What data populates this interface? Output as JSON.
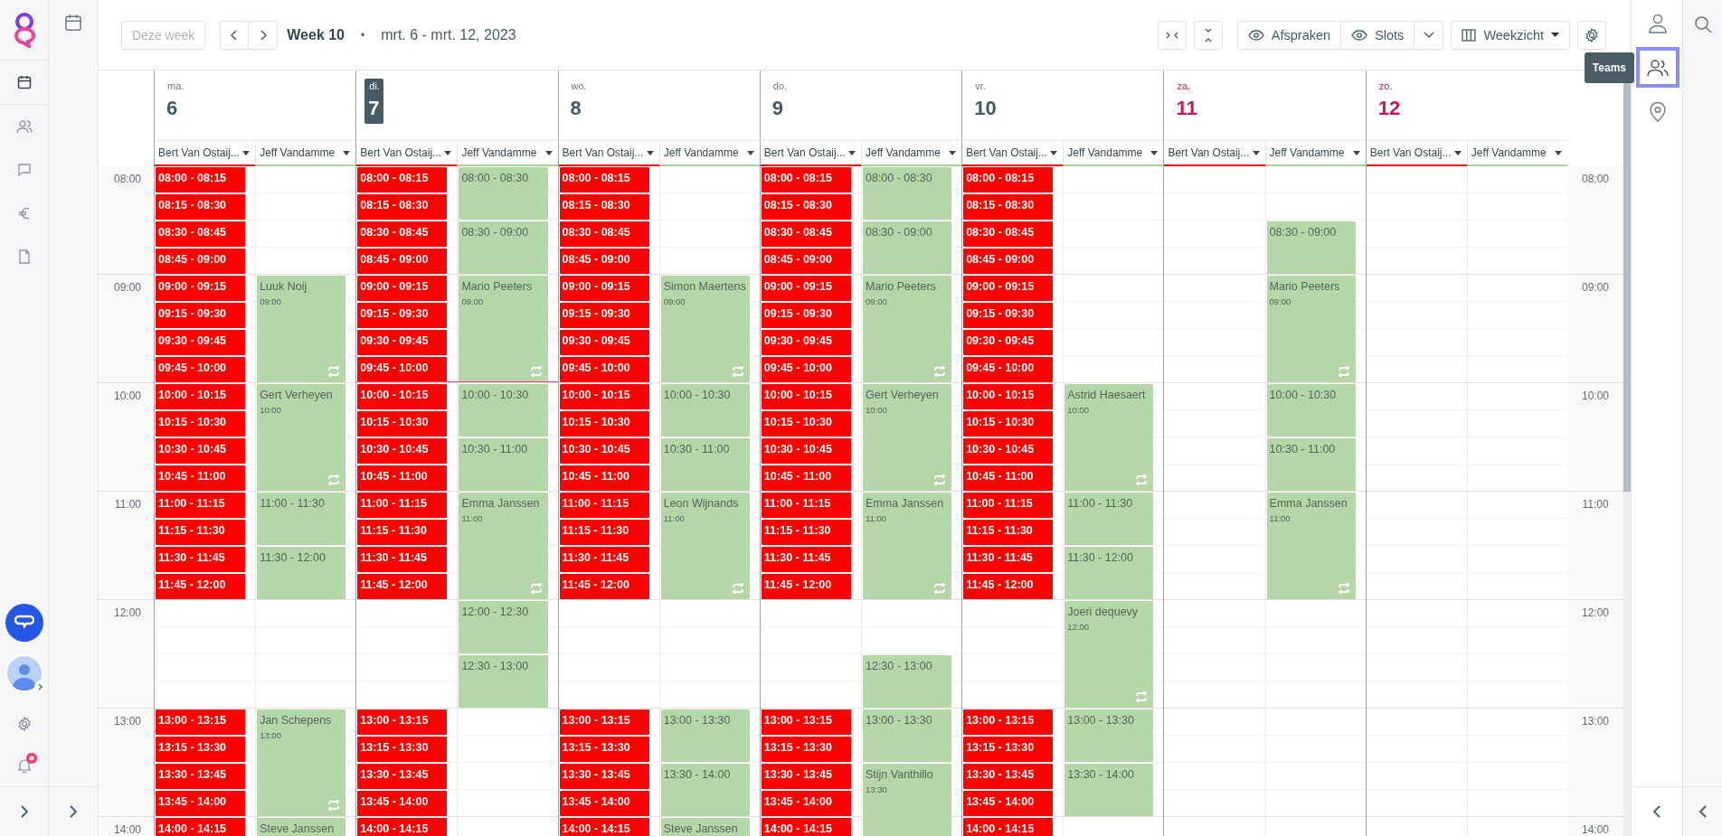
{
  "left_nav": {
    "items": [
      {
        "kind": "calendar",
        "selected": true
      },
      {
        "kind": "people",
        "selected": false
      },
      {
        "kind": "chat",
        "selected": false
      },
      {
        "kind": "euro",
        "selected": false
      },
      {
        "kind": "document",
        "selected": false
      }
    ],
    "notifications": {
      "unread": true
    }
  },
  "toolbar": {
    "today_button": {
      "label": "Deze week",
      "disabled": true
    },
    "week_label": "Week 10",
    "separator": "•",
    "date_range": "mrt. 6 - mrt. 12, 2023",
    "toggles": [
      {
        "label": "Afspraken",
        "visible": true
      },
      {
        "label": "Slots",
        "visible": true
      }
    ],
    "view_select": "Weekzicht"
  },
  "times_left": [
    "08:00",
    "09:00",
    "10:00",
    "11:00",
    "12:00",
    "13:00",
    "14:00"
  ],
  "times_right": [
    "08:00",
    "09:00",
    "10:00",
    "11:00",
    "12:00",
    "13:00",
    "14:00"
  ],
  "days": [
    {
      "weekday": "ma.",
      "date": "6",
      "selected": false,
      "weekend": false,
      "columns": [
        {
          "resource": "Bert Van Ostaij...",
          "color": "#ff0000",
          "blocks": [
            {
              "kind": "slot",
              "label": "08:00 - 08:15"
            },
            {
              "kind": "slot",
              "label": "08:15 - 08:30"
            },
            {
              "kind": "slot",
              "label": "08:30 - 08:45"
            },
            {
              "kind": "slot",
              "label": "08:45 - 09:00"
            },
            {
              "kind": "slot",
              "label": "09:00 - 09:15"
            },
            {
              "kind": "slot",
              "label": "09:15 - 09:30"
            },
            {
              "kind": "slot",
              "label": "09:30 - 09:45"
            },
            {
              "kind": "slot",
              "label": "09:45 - 10:00"
            },
            {
              "kind": "slot",
              "label": "10:00 - 10:15"
            },
            {
              "kind": "slot",
              "label": "10:15 - 10:30"
            },
            {
              "kind": "slot",
              "label": "10:30 - 10:45"
            },
            {
              "kind": "slot",
              "label": "10:45 - 11:00"
            },
            {
              "kind": "slot",
              "label": "11:00 - 11:15"
            },
            {
              "kind": "slot",
              "label": "11:15 - 11:30"
            },
            {
              "kind": "slot",
              "label": "11:30 - 11:45"
            },
            {
              "kind": "slot",
              "label": "11:45 - 12:00"
            },
            {
              "kind": "free"
            },
            {
              "kind": "free"
            },
            {
              "kind": "free"
            },
            {
              "kind": "free"
            },
            {
              "kind": "slot",
              "label": "13:00 - 13:15"
            },
            {
              "kind": "slot",
              "label": "13:15 - 13:30"
            },
            {
              "kind": "slot",
              "label": "13:30 - 13:45"
            },
            {
              "kind": "slot",
              "label": "13:45 - 14:00"
            },
            {
              "kind": "slot",
              "label": "14:00 - 14:15"
            }
          ]
        },
        {
          "resource": "Jeff Vandamme",
          "color": "#a5d196",
          "blocks": [
            {
              "kind": "free"
            },
            {
              "kind": "free"
            },
            {
              "kind": "free"
            },
            {
              "kind": "free"
            },
            {
              "kind": "appointment",
              "name": "Luuk Noij",
              "time": "09:00",
              "repeat": true
            },
            {
              "kind": "appointment",
              "name": "Gert Verheyen",
              "time": "10:00",
              "repeat": true
            },
            {
              "kind": "open",
              "label": "11:00 - 11:30"
            },
            {
              "kind": "open",
              "label": "11:30 - 12:00"
            },
            {
              "kind": "free"
            },
            {
              "kind": "free"
            },
            {
              "kind": "free"
            },
            {
              "kind": "free"
            },
            {
              "kind": "appointment",
              "name": "Jan Schepens",
              "time": "13:00",
              "repeat": true
            },
            {
              "kind": "appointment",
              "name": "Steve Janssen"
            }
          ]
        }
      ]
    },
    {
      "weekday": "di.",
      "date": "7",
      "selected": true,
      "weekend": false,
      "columns": [
        {
          "resource": "Bert Van Ostaij...",
          "color": "#ff0000",
          "blocks": [
            {
              "kind": "slot",
              "label": "08:00 - 08:15"
            },
            {
              "kind": "slot",
              "label": "08:15 - 08:30"
            },
            {
              "kind": "slot",
              "label": "08:30 - 08:45"
            },
            {
              "kind": "slot",
              "label": "08:45 - 09:00"
            },
            {
              "kind": "slot",
              "label": "09:00 - 09:15"
            },
            {
              "kind": "slot",
              "label": "09:15 - 09:30"
            },
            {
              "kind": "slot",
              "label": "09:30 - 09:45"
            },
            {
              "kind": "slot",
              "label": "09:45 - 10:00"
            },
            {
              "kind": "slot",
              "label": "10:00 - 10:15"
            },
            {
              "kind": "slot",
              "label": "10:15 - 10:30"
            },
            {
              "kind": "slot",
              "label": "10:30 - 10:45"
            },
            {
              "kind": "slot",
              "label": "10:45 - 11:00"
            },
            {
              "kind": "slot",
              "label": "11:00 - 11:15"
            },
            {
              "kind": "slot",
              "label": "11:15 - 11:30"
            },
            {
              "kind": "slot",
              "label": "11:30 - 11:45"
            },
            {
              "kind": "slot",
              "label": "11:45 - 12:00"
            },
            {
              "kind": "free"
            },
            {
              "kind": "free"
            },
            {
              "kind": "free"
            },
            {
              "kind": "free"
            },
            {
              "kind": "slot",
              "label": "13:00 - 13:15"
            },
            {
              "kind": "slot",
              "label": "13:15 - 13:30"
            },
            {
              "kind": "slot",
              "label": "13:30 - 13:45"
            },
            {
              "kind": "slot",
              "label": "13:45 - 14:00"
            },
            {
              "kind": "slot",
              "label": "14:00 - 14:15"
            }
          ]
        },
        {
          "resource": "Jeff Vandamme",
          "color": "#a5d196",
          "blocks": [
            {
              "kind": "open",
              "label": "08:00 - 08:30"
            },
            {
              "kind": "open",
              "label": "08:30 - 09:00"
            },
            {
              "kind": "appointment",
              "name": "Mario Peeters",
              "time": "09:00",
              "repeat": true
            },
            {
              "kind": "open",
              "label": "10:00 - 10:30"
            },
            {
              "kind": "open",
              "label": "10:30 - 11:00"
            },
            {
              "kind": "appointment",
              "name": "Emma Janssen",
              "time": "11:00",
              "repeat": true
            },
            {
              "kind": "open",
              "label": "12:00 - 12:30"
            },
            {
              "kind": "open",
              "label": "12:30 - 13:00"
            }
          ]
        }
      ]
    },
    {
      "weekday": "wo.",
      "date": "8",
      "selected": false,
      "weekend": false,
      "columns": [
        {
          "resource": "Bert Van Ostaij...",
          "color": "#ff0000",
          "blocks": [
            {
              "kind": "slot",
              "label": "08:00 - 08:15"
            },
            {
              "kind": "slot",
              "label": "08:15 - 08:30"
            },
            {
              "kind": "slot",
              "label": "08:30 - 08:45"
            },
            {
              "kind": "slot",
              "label": "08:45 - 09:00"
            },
            {
              "kind": "slot",
              "label": "09:00 - 09:15"
            },
            {
              "kind": "slot",
              "label": "09:15 - 09:30"
            },
            {
              "kind": "slot",
              "label": "09:30 - 09:45"
            },
            {
              "kind": "slot",
              "label": "09:45 - 10:00"
            },
            {
              "kind": "slot",
              "label": "10:00 - 10:15"
            },
            {
              "kind": "slot",
              "label": "10:15 - 10:30"
            },
            {
              "kind": "slot",
              "label": "10:30 - 10:45"
            },
            {
              "kind": "slot",
              "label": "10:45 - 11:00"
            },
            {
              "kind": "slot",
              "label": "11:00 - 11:15"
            },
            {
              "kind": "slot",
              "label": "11:15 - 11:30"
            },
            {
              "kind": "slot",
              "label": "11:30 - 11:45"
            },
            {
              "kind": "slot",
              "label": "11:45 - 12:00"
            },
            {
              "kind": "free"
            },
            {
              "kind": "free"
            },
            {
              "kind": "free"
            },
            {
              "kind": "free"
            },
            {
              "kind": "slot",
              "label": "13:00 - 13:15"
            },
            {
              "kind": "slot",
              "label": "13:15 - 13:30"
            },
            {
              "kind": "slot",
              "label": "13:30 - 13:45"
            },
            {
              "kind": "slot",
              "label": "13:45 - 14:00"
            },
            {
              "kind": "slot",
              "label": "14:00 - 14:15"
            }
          ]
        },
        {
          "resource": "Jeff Vandamme",
          "color": "#a5d196",
          "blocks": [
            {
              "kind": "free"
            },
            {
              "kind": "free"
            },
            {
              "kind": "free"
            },
            {
              "kind": "free"
            },
            {
              "kind": "appointment",
              "name": "Simon Maertens",
              "time": "09:00",
              "repeat": true
            },
            {
              "kind": "open",
              "label": "10:00 - 10:30"
            },
            {
              "kind": "open",
              "label": "10:30 - 11:00"
            },
            {
              "kind": "appointment",
              "name": "Leon Wijnands",
              "time": "11:00",
              "repeat": true
            },
            {
              "kind": "free"
            },
            {
              "kind": "free"
            },
            {
              "kind": "free"
            },
            {
              "kind": "free"
            },
            {
              "kind": "open",
              "label": "13:00 - 13:30"
            },
            {
              "kind": "open",
              "label": "13:30 - 14:00"
            },
            {
              "kind": "appointment",
              "name": "Steve Janssen"
            }
          ]
        }
      ]
    },
    {
      "weekday": "do.",
      "date": "9",
      "selected": false,
      "weekend": false,
      "columns": [
        {
          "resource": "Bert Van Ostaij...",
          "color": "#ff0000",
          "blocks": [
            {
              "kind": "slot",
              "label": "08:00 - 08:15"
            },
            {
              "kind": "slot",
              "label": "08:15 - 08:30"
            },
            {
              "kind": "slot",
              "label": "08:30 - 08:45"
            },
            {
              "kind": "slot",
              "label": "08:45 - 09:00"
            },
            {
              "kind": "slot",
              "label": "09:00 - 09:15"
            },
            {
              "kind": "slot",
              "label": "09:15 - 09:30"
            },
            {
              "kind": "slot",
              "label": "09:30 - 09:45"
            },
            {
              "kind": "slot",
              "label": "09:45 - 10:00"
            },
            {
              "kind": "slot",
              "label": "10:00 - 10:15"
            },
            {
              "kind": "slot",
              "label": "10:15 - 10:30"
            },
            {
              "kind": "slot",
              "label": "10:30 - 10:45"
            },
            {
              "kind": "slot",
              "label": "10:45 - 11:00"
            },
            {
              "kind": "slot",
              "label": "11:00 - 11:15"
            },
            {
              "kind": "slot",
              "label": "11:15 - 11:30"
            },
            {
              "kind": "slot",
              "label": "11:30 - 11:45"
            },
            {
              "kind": "slot",
              "label": "11:45 - 12:00"
            },
            {
              "kind": "free"
            },
            {
              "kind": "free"
            },
            {
              "kind": "free"
            },
            {
              "kind": "free"
            },
            {
              "kind": "slot",
              "label": "13:00 - 13:15"
            },
            {
              "kind": "slot",
              "label": "13:15 - 13:30"
            },
            {
              "kind": "slot",
              "label": "13:30 - 13:45"
            },
            {
              "kind": "slot",
              "label": "13:45 - 14:00"
            },
            {
              "kind": "slot",
              "label": "14:00 - 14:15"
            }
          ]
        },
        {
          "resource": "Jeff Vandamme",
          "color": "#a5d196",
          "blocks": [
            {
              "kind": "open",
              "label": "08:00 - 08:30"
            },
            {
              "kind": "open",
              "label": "08:30 - 09:00"
            },
            {
              "kind": "appointment",
              "name": "Mario Peeters",
              "time": "09:00",
              "repeat": true
            },
            {
              "kind": "appointment",
              "name": "Gert Verheyen",
              "time": "10:00",
              "repeat": true
            },
            {
              "kind": "appointment",
              "name": "Emma Janssen",
              "time": "11:00",
              "repeat": true
            },
            {
              "kind": "free"
            },
            {
              "kind": "free"
            },
            {
              "kind": "open",
              "label": "12:30 - 13:00"
            },
            {
              "kind": "open",
              "label": "13:00 - 13:30"
            },
            {
              "kind": "appointment",
              "name": "Stijn Vanthillo",
              "time": "13:30"
            }
          ]
        }
      ]
    },
    {
      "weekday": "vr.",
      "date": "10",
      "selected": false,
      "weekend": false,
      "columns": [
        {
          "resource": "Bert Van Ostaij...",
          "color": "#ff0000",
          "blocks": [
            {
              "kind": "slot",
              "label": "08:00 - 08:15"
            },
            {
              "kind": "slot",
              "label": "08:15 - 08:30"
            },
            {
              "kind": "slot",
              "label": "08:30 - 08:45"
            },
            {
              "kind": "slot",
              "label": "08:45 - 09:00"
            },
            {
              "kind": "slot",
              "label": "09:00 - 09:15"
            },
            {
              "kind": "slot",
              "label": "09:15 - 09:30"
            },
            {
              "kind": "slot",
              "label": "09:30 - 09:45"
            },
            {
              "kind": "slot",
              "label": "09:45 - 10:00"
            },
            {
              "kind": "slot",
              "label": "10:00 - 10:15"
            },
            {
              "kind": "slot",
              "label": "10:15 - 10:30"
            },
            {
              "kind": "slot",
              "label": "10:30 - 10:45"
            },
            {
              "kind": "slot",
              "label": "10:45 - 11:00"
            },
            {
              "kind": "slot",
              "label": "11:00 - 11:15"
            },
            {
              "kind": "slot",
              "label": "11:15 - 11:30"
            },
            {
              "kind": "slot",
              "label": "11:30 - 11:45"
            },
            {
              "kind": "slot",
              "label": "11:45 - 12:00"
            },
            {
              "kind": "free"
            },
            {
              "kind": "free"
            },
            {
              "kind": "free"
            },
            {
              "kind": "free"
            },
            {
              "kind": "slot",
              "label": "13:00 - 13:15"
            },
            {
              "kind": "slot",
              "label": "13:15 - 13:30"
            },
            {
              "kind": "slot",
              "label": "13:30 - 13:45"
            },
            {
              "kind": "slot",
              "label": "13:45 - 14:00"
            },
            {
              "kind": "slot",
              "label": "14:00 - 14:15"
            }
          ]
        },
        {
          "resource": "Jeff Vandamme",
          "color": "#a5d196",
          "blocks": [
            {
              "kind": "free"
            },
            {
              "kind": "free"
            },
            {
              "kind": "free"
            },
            {
              "kind": "free"
            },
            {
              "kind": "free"
            },
            {
              "kind": "free"
            },
            {
              "kind": "free"
            },
            {
              "kind": "free"
            },
            {
              "kind": "appointment",
              "name": "Astrid Haesaert",
              "time": "10:00",
              "repeat": true
            },
            {
              "kind": "open",
              "label": "11:00 - 11:30"
            },
            {
              "kind": "open",
              "label": "11:30 - 12:00"
            },
            {
              "kind": "appointment",
              "name": "Joeri dequevy",
              "time": "12:00",
              "repeat": true
            },
            {
              "kind": "open",
              "label": "13:00 - 13:30"
            },
            {
              "kind": "open",
              "label": "13:30 - 14:00"
            }
          ]
        }
      ]
    },
    {
      "weekday": "za.",
      "date": "11",
      "selected": false,
      "weekend": true,
      "columns": [
        {
          "resource": "Bert Van Ostaij...",
          "color": "#ff0000"
        },
        {
          "resource": "Jeff Vandamme",
          "color": "#a5d196",
          "blocks": [
            {
              "kind": "free"
            },
            {
              "kind": "free"
            },
            {
              "kind": "open",
              "label": "08:30 - 09:00"
            },
            {
              "kind": "appointment",
              "name": "Mario Peeters",
              "time": "09:00",
              "repeat": true
            },
            {
              "kind": "open",
              "label": "10:00 - 10:30"
            },
            {
              "kind": "open",
              "label": "10:30 - 11:00"
            },
            {
              "kind": "appointment",
              "name": "Emma Janssen",
              "time": "11:00",
              "repeat": true
            }
          ]
        }
      ]
    },
    {
      "weekday": "zo.",
      "date": "12",
      "selected": false,
      "weekend": true,
      "columns": [
        {
          "resource": "Bert Van Ostaij...",
          "color": "#ff0000"
        },
        {
          "resource": "Jeff Vandamme",
          "color": "#a5d196"
        }
      ]
    }
  ],
  "right_nav": {
    "items": [
      {
        "kind": "user",
        "selected": false
      },
      {
        "kind": "teams",
        "selected": true
      },
      {
        "kind": "location",
        "selected": false
      }
    ],
    "tooltip": "Teams"
  }
}
